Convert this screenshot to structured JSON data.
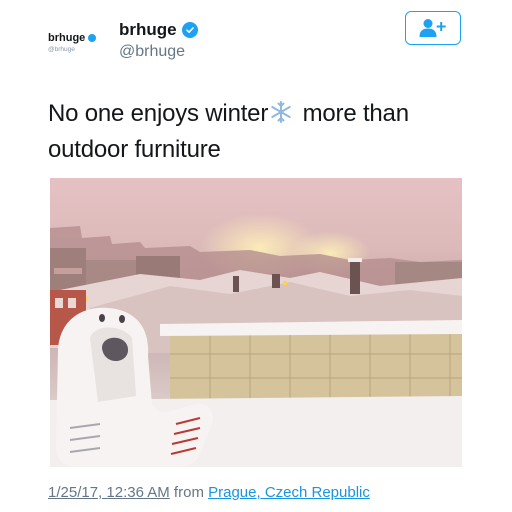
{
  "avatar": {
    "name": "brhuge",
    "handle": "@brhuge"
  },
  "user": {
    "display_name": "brhuge",
    "username": "@brhuge",
    "verified": true
  },
  "follow_button": {
    "icon": "add-user-icon"
  },
  "tweet": {
    "text_before_emoji": "No one enjoys winter",
    "emoji": "snowflake",
    "text_after_emoji": " more than outdoor furniture"
  },
  "photo": {
    "subject": "snow-covered-chair-on-balcony"
  },
  "footer": {
    "timestamp": "1/25/17, 12:36 AM",
    "from_label": " from ",
    "location": "Prague, Czech Republic"
  },
  "colors": {
    "accent": "#1da1f2",
    "link": "#1b95e0",
    "muted": "#657786",
    "text": "#14171a"
  }
}
